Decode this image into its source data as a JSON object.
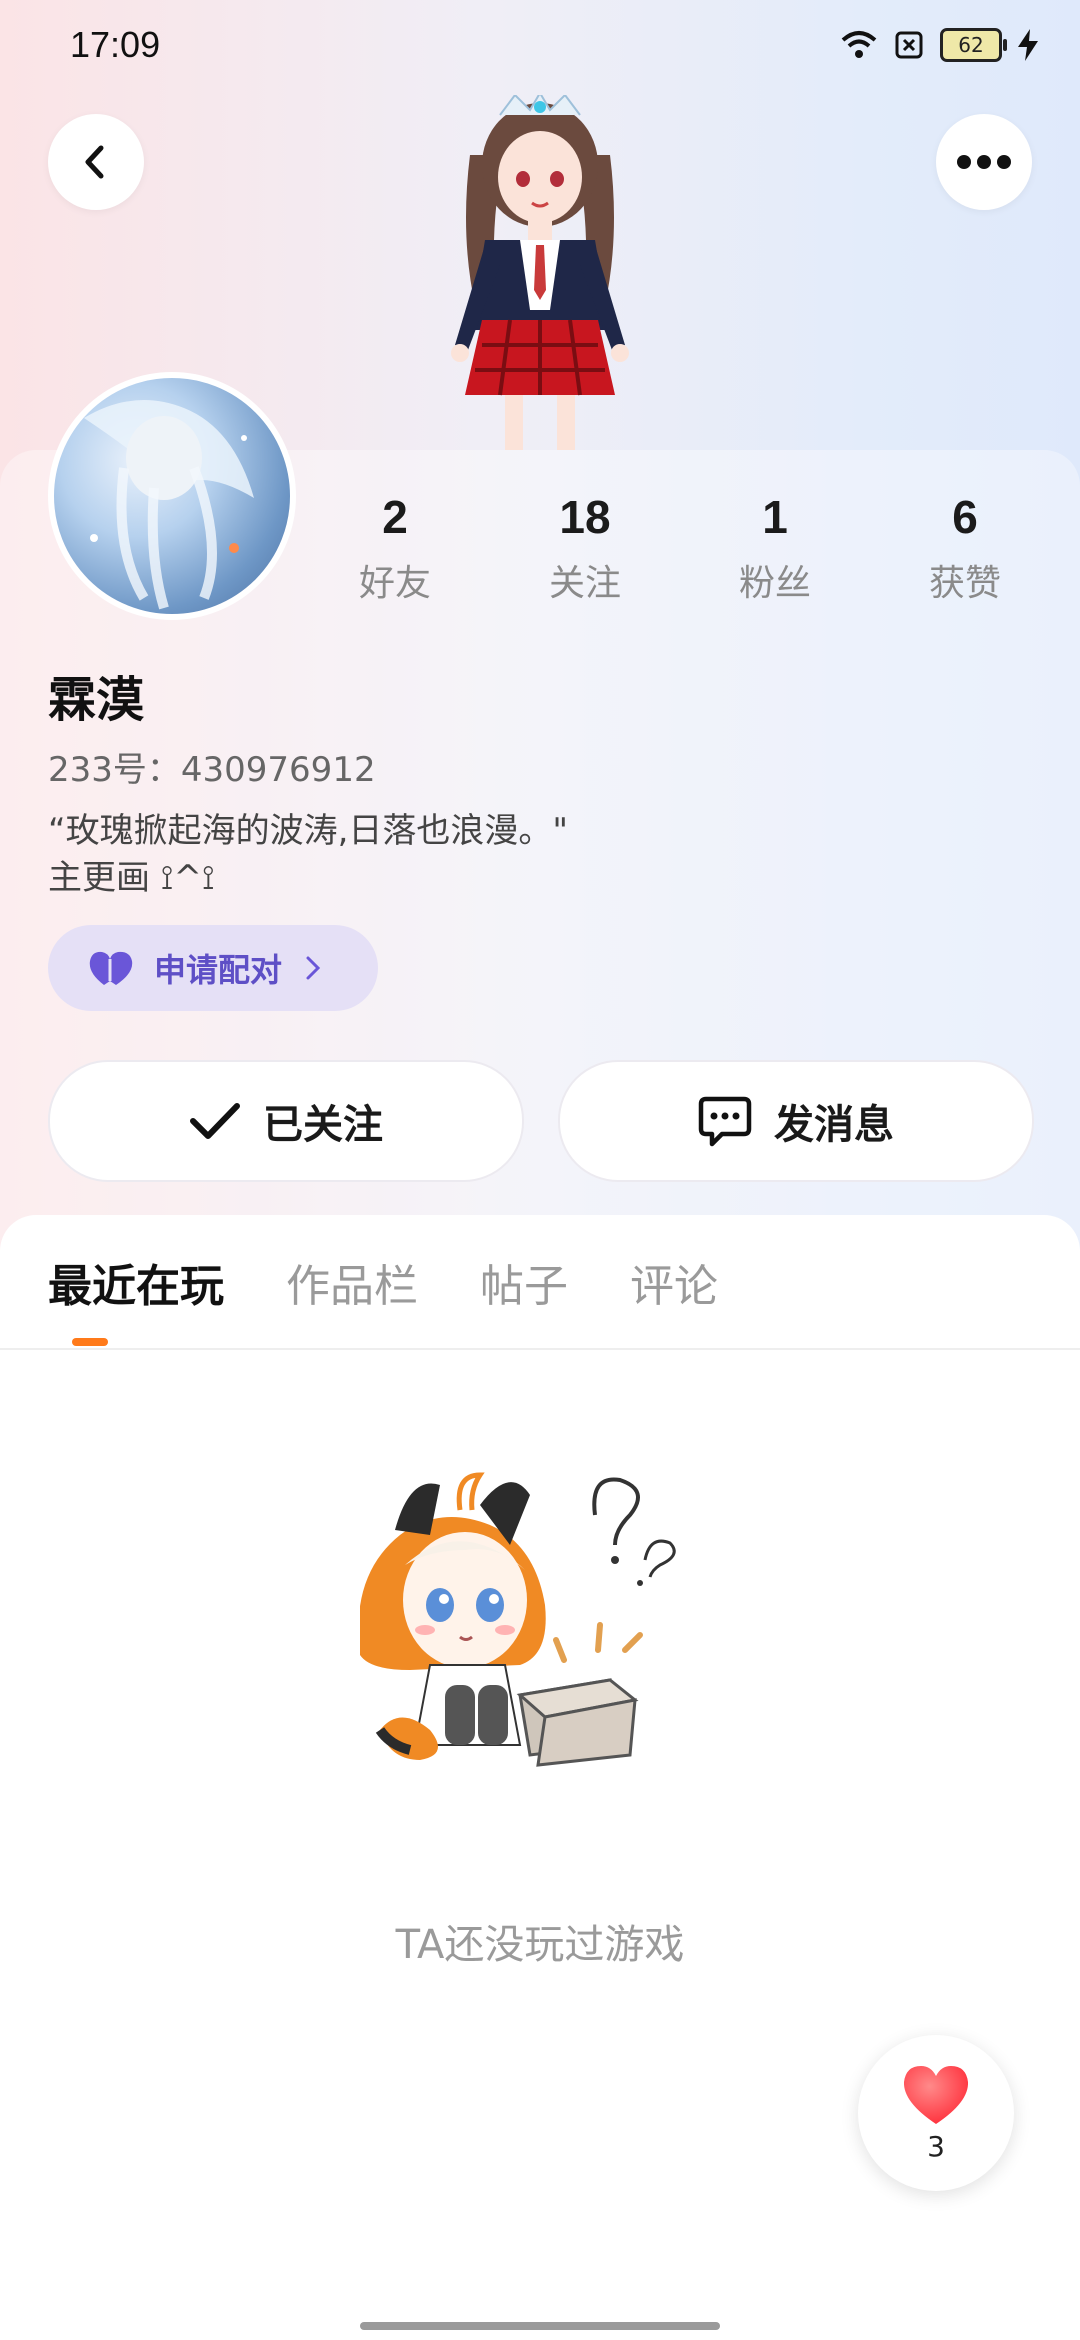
{
  "status_bar": {
    "time": "17:09",
    "battery": "62"
  },
  "header": {
    "back_icon": "chevron-left-icon",
    "more_icon": "more-horizontal-icon"
  },
  "profile": {
    "stats": [
      {
        "value": "2",
        "label": "好友"
      },
      {
        "value": "18",
        "label": "关注"
      },
      {
        "value": "1",
        "label": "粉丝"
      },
      {
        "value": "6",
        "label": "获赞"
      }
    ],
    "name": "霖漠",
    "id_line": "233号：430976912",
    "bio": "“玫瑰掀起海的波涛,日落也浪漫。\"\n主更画 ⟟^⟟",
    "pair_button": "申请配对"
  },
  "actions": {
    "follow": "已关注",
    "message": "发消息"
  },
  "tabs": [
    "最近在玩",
    "作品栏",
    "帖子",
    "评论"
  ],
  "empty_state": {
    "text": "TA还没玩过游戏"
  },
  "like_fab": {
    "count": "3"
  },
  "colors": {
    "accent": "#ff7a1a",
    "pair_bg": "#e5e0f6",
    "pair_text": "#5e4fc6",
    "heart": "#ff3b3b"
  }
}
